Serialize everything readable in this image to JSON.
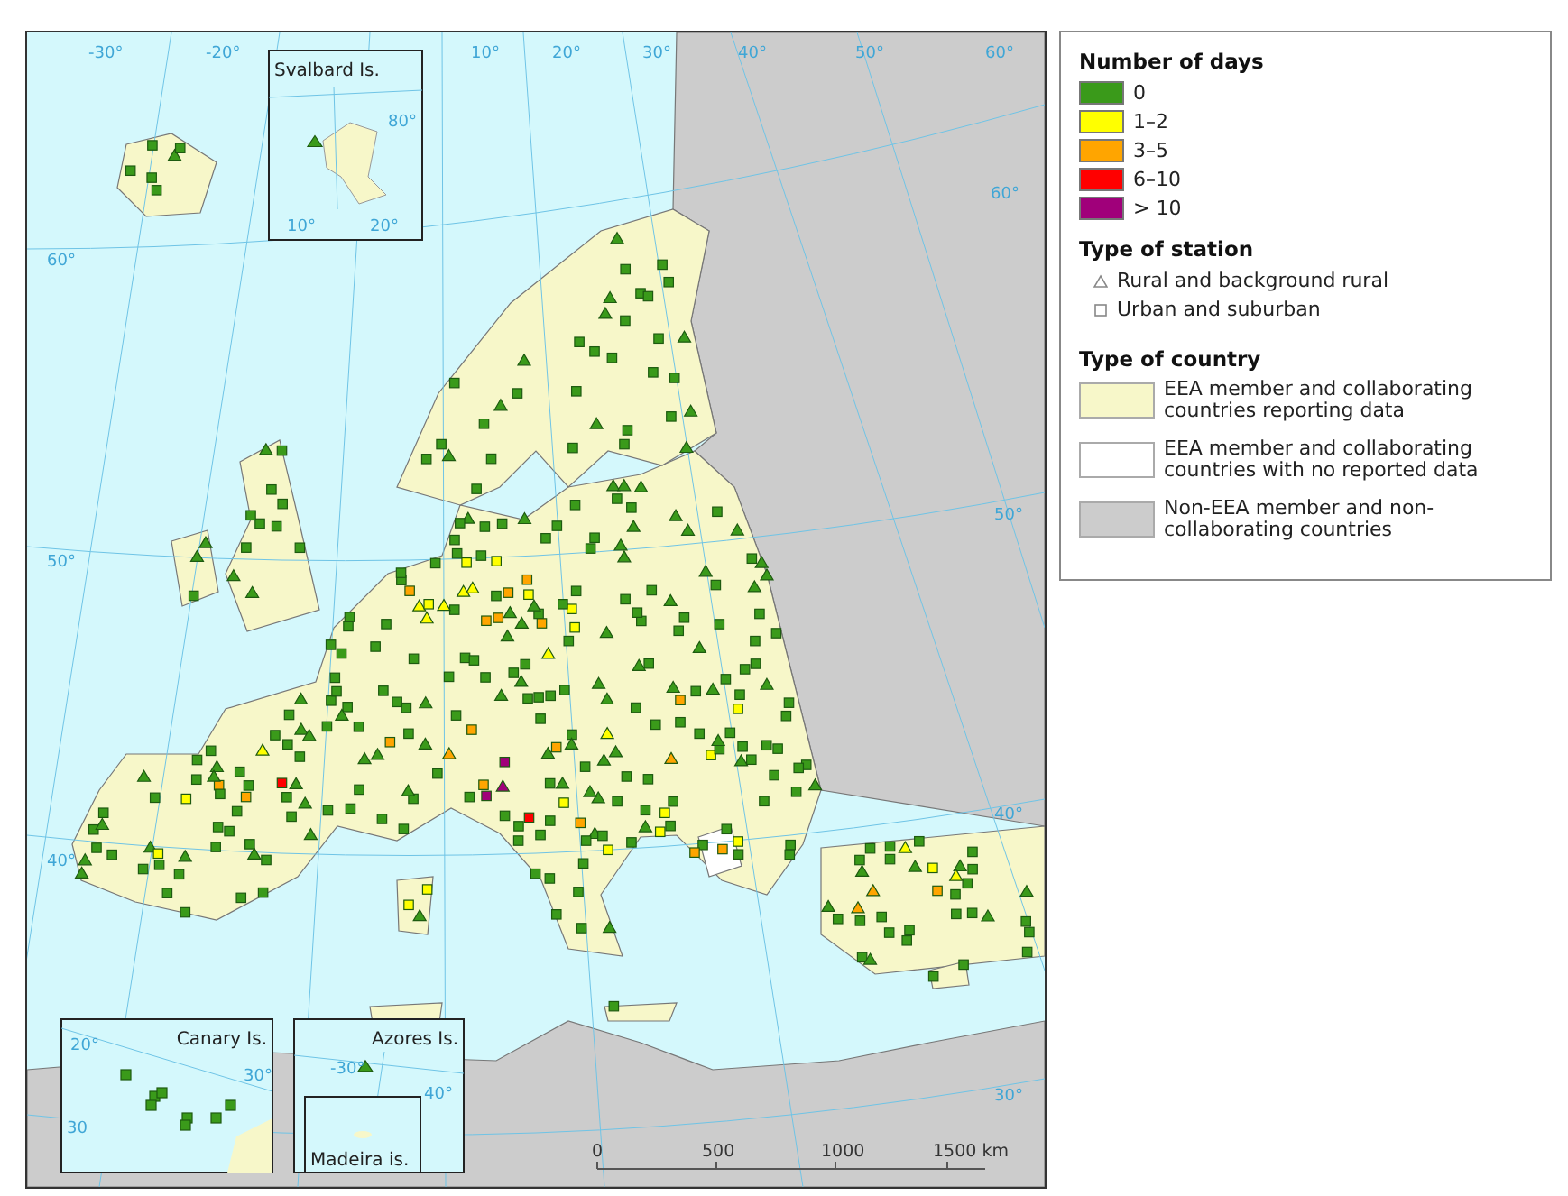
{
  "map": {
    "graticule_labels": [
      "-30°",
      "-20°",
      "10°",
      "20°",
      "30°",
      "40°",
      "50°",
      "60°",
      "60°",
      "60°",
      "50°",
      "40°",
      "50°",
      "40°",
      "30°"
    ],
    "insets": [
      {
        "kind": "svalbard",
        "title": "Svalbard Is.",
        "labels": [
          "80°",
          "10°",
          "20°"
        ]
      },
      {
        "kind": "canary",
        "title": "Canary Is.",
        "labels": [
          "20°",
          "30°",
          "30"
        ]
      },
      {
        "kind": "azores",
        "title": "Azores Is.",
        "labels": [
          "-30°",
          "40°"
        ]
      },
      {
        "kind": "madeira",
        "title": "Madeira is."
      }
    ],
    "scale_bar": {
      "labels": [
        "0",
        "500",
        "1000",
        "1500 km"
      ]
    }
  },
  "legend": {
    "sections": [
      {
        "kind": "swatches",
        "title": "Number of days",
        "items": [
          {
            "label": "0",
            "color": "#3a9a1a"
          },
          {
            "label": "1–2",
            "color": "#ffff00"
          },
          {
            "label": "3–5",
            "color": "#ffa500"
          },
          {
            "label": "6–10",
            "color": "#ff0000"
          },
          {
            "label": "> 10",
            "color": "#a0007a"
          }
        ]
      },
      {
        "kind": "symbols",
        "title": "Type of station",
        "items": [
          {
            "label": "Rural and background rural",
            "kind": "triangle"
          },
          {
            "label": "Urban and suburban",
            "kind": "square"
          }
        ]
      },
      {
        "kind": "areas",
        "title": "Type of country",
        "items": [
          {
            "label": "EEA member and collaborating countries reporting data",
            "color": "#f7f7c9"
          },
          {
            "label": "EEA member and collaborating countries with no reported data",
            "color": "#ffffff"
          },
          {
            "label": "Non-EEA member and non-collaborating countries",
            "color": "#cccccc"
          }
        ]
      }
    ]
  }
}
